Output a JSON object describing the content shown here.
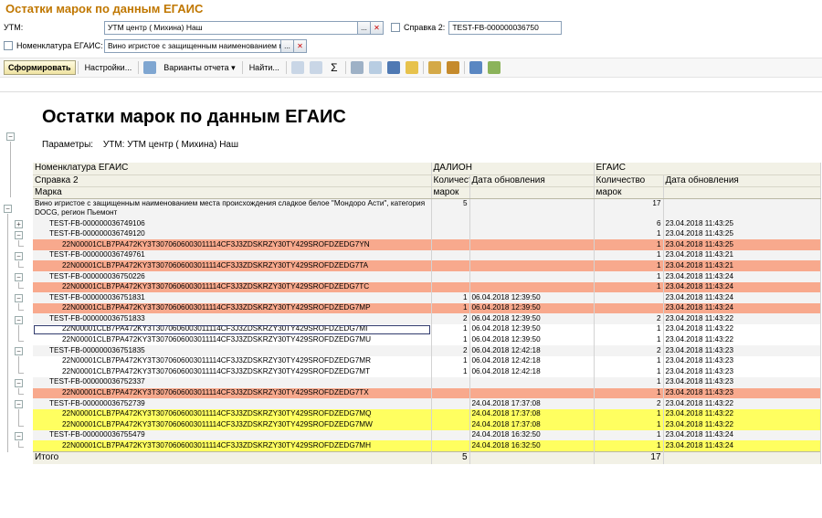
{
  "window": {
    "title": "Остатки марок по данным ЕГАИС"
  },
  "filters": {
    "utm_label": "УТМ:",
    "utm_value": "УТМ центр ( Михина) Наш",
    "spravka2_label": "Справка 2:",
    "spravka2_value": "TEST-FB-000000036750",
    "nomenclature_label": "Номенклатура ЕГАИС:",
    "nomenclature_value": "Вино игристое с защищенным наименованием места про",
    "select_btn": "...",
    "clear_btn": "✕"
  },
  "toolbar": {
    "generate": "Сформировать",
    "settings": "Настройки...",
    "variants": "Варианты отчета ▾",
    "find": "Найти...",
    "icons": [
      "copy-icon",
      "paste-icon",
      "sum-icon",
      "print-icon",
      "preview-icon",
      "save-icon",
      "mail-icon",
      "copy2-icon",
      "paste2-icon",
      "export-icon",
      "import-icon"
    ]
  },
  "report": {
    "title": "Остатки марок по данным ЕГАИС",
    "params_label": "Параметры:",
    "params_value": "УТМ: УТМ центр ( Михина) Наш",
    "headers": {
      "col0": [
        "Номенклатура ЕГАИС",
        "Справка 2",
        "Марка"
      ],
      "dalion": "ДАЛИОН",
      "egais": "ЕГАИС",
      "qty": "Количество",
      "qty2": "марок",
      "date": "Дата обновления"
    },
    "product": {
      "name": "Вино игристое с защищенным наименованием места происхождения сладкое белое \"Мондоро Асти\", категория DOCG, регион Пьемонт",
      "dalion_qty": "5",
      "egais_qty": "17"
    },
    "rows": [
      {
        "t": "doc",
        "name": "TEST-FB-000000036749106",
        "dq": "",
        "dd": "",
        "eq": "6",
        "ed": "23.04.2018 11:43:25"
      },
      {
        "t": "doc",
        "name": "TEST-FB-000000036749120",
        "dq": "",
        "dd": "",
        "eq": "1",
        "ed": "23.04.2018 11:43:25"
      },
      {
        "t": "orange",
        "name": "22N00001CLB7PA472KY3T3070606003011114CF3J3ZDSKRZY30TY429SROFDZEDG7YN",
        "dq": "",
        "dd": "",
        "eq": "1",
        "ed": "23.04.2018 11:43:25"
      },
      {
        "t": "doc",
        "name": "TEST-FB-000000036749761",
        "dq": "",
        "dd": "",
        "eq": "1",
        "ed": "23.04.2018 11:43:21"
      },
      {
        "t": "orange",
        "name": "22N00001CLB7PA472KY3T3070606003011114CF3J3ZDSKRZY30TY429SROFDZEDG7TA",
        "dq": "",
        "dd": "",
        "eq": "1",
        "ed": "23.04.2018 11:43:21"
      },
      {
        "t": "doc",
        "name": "TEST-FB-000000036750226",
        "dq": "",
        "dd": "",
        "eq": "1",
        "ed": "23.04.2018 11:43:24"
      },
      {
        "t": "orange",
        "name": "22N00001CLB7PA472KY3T3070606003011114CF3J3ZDSKRZY30TY429SROFDZEDG7TC",
        "dq": "",
        "dd": "",
        "eq": "1",
        "ed": "23.04.2018 11:43:24"
      },
      {
        "t": "doc",
        "name": "TEST-FB-000000036751831",
        "dq": "1",
        "dd": "06.04.2018 12:39:50",
        "eq": "",
        "ed": "23.04.2018 11:43:24"
      },
      {
        "t": "orange",
        "name": "22N00001CLB7PA472KY3T3070606003011114CF3J3ZDSKRZY30TY429SROFDZEDG7MP",
        "dq": "1",
        "dd": "06.04.2018 12:39:50",
        "eq": "",
        "ed": "23.04.2018 11:43:24"
      },
      {
        "t": "doc",
        "name": "TEST-FB-000000036751833",
        "dq": "2",
        "dd": "06.04.2018 12:39:50",
        "eq": "2",
        "ed": "23.04.2018 11:43:22"
      },
      {
        "t": "mark",
        "sel": true,
        "name": "22N00001CLB7PA472KY3T3070606003011114CF3J3ZDSKRZY30TY429SROFDZEDG7MI",
        "dq": "1",
        "dd": "06.04.2018 12:39:50",
        "eq": "1",
        "ed": "23.04.2018 11:43:22"
      },
      {
        "t": "mark",
        "name": "22N00001CLB7PA472KY3T3070606003011114CF3J3ZDSKRZY30TY429SROFDZEDG7MU",
        "dq": "1",
        "dd": "06.04.2018 12:39:50",
        "eq": "1",
        "ed": "23.04.2018 11:43:22"
      },
      {
        "t": "doc",
        "name": "TEST-FB-000000036751835",
        "dq": "2",
        "dd": "06.04.2018 12:42:18",
        "eq": "2",
        "ed": "23.04.2018 11:43:23"
      },
      {
        "t": "mark",
        "name": "22N00001CLB7PA472KY3T3070606003011114CF3J3ZDSKRZY30TY429SROFDZEDG7MR",
        "dq": "1",
        "dd": "06.04.2018 12:42:18",
        "eq": "1",
        "ed": "23.04.2018 11:43:23"
      },
      {
        "t": "mark",
        "name": "22N00001CLB7PA472KY3T3070606003011114CF3J3ZDSKRZY30TY429SROFDZEDG7MT",
        "dq": "1",
        "dd": "06.04.2018 12:42:18",
        "eq": "1",
        "ed": "23.04.2018 11:43:23"
      },
      {
        "t": "doc",
        "name": "TEST-FB-000000036752337",
        "dq": "",
        "dd": "",
        "eq": "1",
        "ed": "23.04.2018 11:43:23"
      },
      {
        "t": "orange",
        "name": "22N00001CLB7PA472KY3T3070606003011114CF3J3ZDSKRZY30TY429SROFDZEDG7TX",
        "dq": "",
        "dd": "",
        "eq": "1",
        "ed": "23.04.2018 11:43:23"
      },
      {
        "t": "doc",
        "name": "TEST-FB-000000036752739",
        "dq": "",
        "dd": "24.04.2018 17:37:08",
        "eq": "2",
        "ed": "23.04.2018 11:43:22"
      },
      {
        "t": "yellow",
        "name": "22N00001CLB7PA472KY3T3070606003011114CF3J3ZDSKRZY30TY429SROFDZEDG7MQ",
        "dq": "",
        "dd": "24.04.2018 17:37:08",
        "eq": "1",
        "ed": "23.04.2018 11:43:22"
      },
      {
        "t": "yellow",
        "name": "22N00001CLB7PA472KY3T3070606003011114CF3J3ZDSKRZY30TY429SROFDZEDG7MW",
        "dq": "",
        "dd": "24.04.2018 17:37:08",
        "eq": "1",
        "ed": "23.04.2018 11:43:22"
      },
      {
        "t": "doc",
        "name": "TEST-FB-000000036755479",
        "dq": "",
        "dd": "24.04.2018 16:32:50",
        "eq": "1",
        "ed": "23.04.2018 11:43:24"
      },
      {
        "t": "yellow",
        "name": "22N00001CLB7PA472KY3T3070606003011114CF3J3ZDSKRZY30TY429SROFDZEDG7MH",
        "dq": "",
        "dd": "24.04.2018 16:32:50",
        "eq": "1",
        "ed": "23.04.2018 11:43:24"
      }
    ],
    "total": {
      "label": "Итого",
      "dalion_qty": "5",
      "egais_qty": "17"
    }
  },
  "colors": {
    "orange": "#f8a98d",
    "yellow": "#ffff60",
    "title": "#c07700",
    "header_bg": "#f2f1e6"
  }
}
